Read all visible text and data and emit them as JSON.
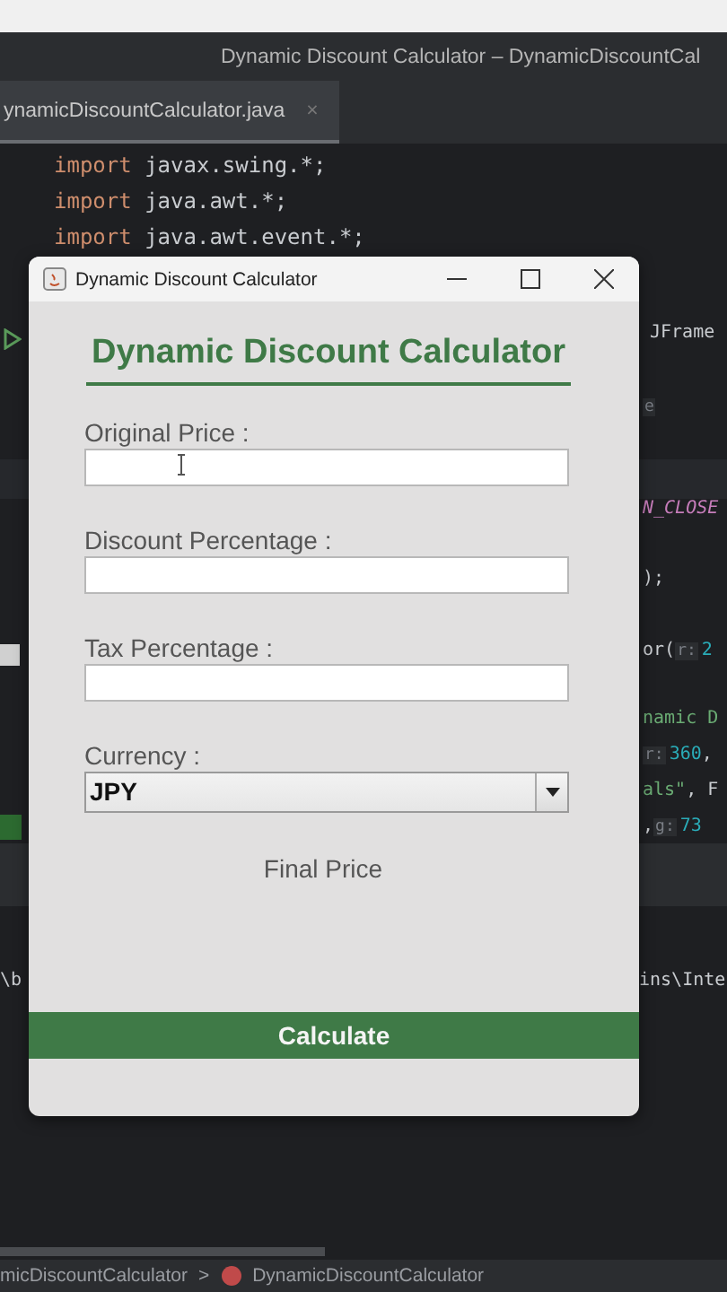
{
  "ide": {
    "window_title": "Dynamic Discount Calculator – DynamicDiscountCal",
    "tab": {
      "label": "ynamicDiscountCalculator.java",
      "close": "×"
    },
    "code_lines": [
      {
        "keyword": "import",
        "text": "javax.swing.*;"
      },
      {
        "keyword": "import",
        "text": "java.awt.*;"
      },
      {
        "keyword": "import",
        "text": "java.awt.event.*;"
      }
    ],
    "code_fragments": [
      {
        "parts": [
          {
            "kind": "plain",
            "text": "JFrame"
          }
        ]
      },
      {
        "parts": [
          {
            "kind": "hint",
            "text": "e"
          }
        ]
      },
      {
        "parts": [
          {
            "kind": "constant",
            "text": "N_CLOSE"
          }
        ]
      },
      {
        "parts": [
          {
            "kind": "plain",
            "text": ");"
          }
        ]
      },
      {
        "parts": [
          {
            "kind": "plain",
            "text": "or("
          },
          {
            "kind": "hint",
            "text": "r:"
          },
          {
            "kind": "number",
            "text": "2"
          }
        ]
      },
      {
        "parts": [
          {
            "kind": "string",
            "text": "namic D"
          }
        ]
      },
      {
        "parts": [
          {
            "kind": "hint",
            "text": "r:"
          },
          {
            "kind": "number",
            "text": "360"
          },
          {
            "kind": "plain",
            "text": ","
          }
        ]
      },
      {
        "parts": [
          {
            "kind": "string",
            "text": "als\""
          },
          {
            "kind": "plain",
            "text": ", F"
          }
        ]
      },
      {
        "parts": [
          {
            "kind": "plain",
            "text": ","
          },
          {
            "kind": "hint",
            "text": "g:"
          },
          {
            "kind": "number",
            "text": "73"
          }
        ]
      }
    ],
    "console_fragments": [
      "\\b",
      "ins\\Inte"
    ],
    "breadcrumb": [
      "micDiscountCalculator",
      ">",
      "DynamicDiscountCalculator"
    ]
  },
  "dialog": {
    "title": "Dynamic Discount Calculator",
    "heading": "Dynamic Discount Calculator",
    "fields": [
      {
        "label": "Original Price :"
      },
      {
        "label": "Discount Percentage :"
      },
      {
        "label": "Tax Percentage :"
      }
    ],
    "currency": {
      "label": "Currency :",
      "value": "JPY"
    },
    "result": "Final Price",
    "button": "Calculate"
  }
}
